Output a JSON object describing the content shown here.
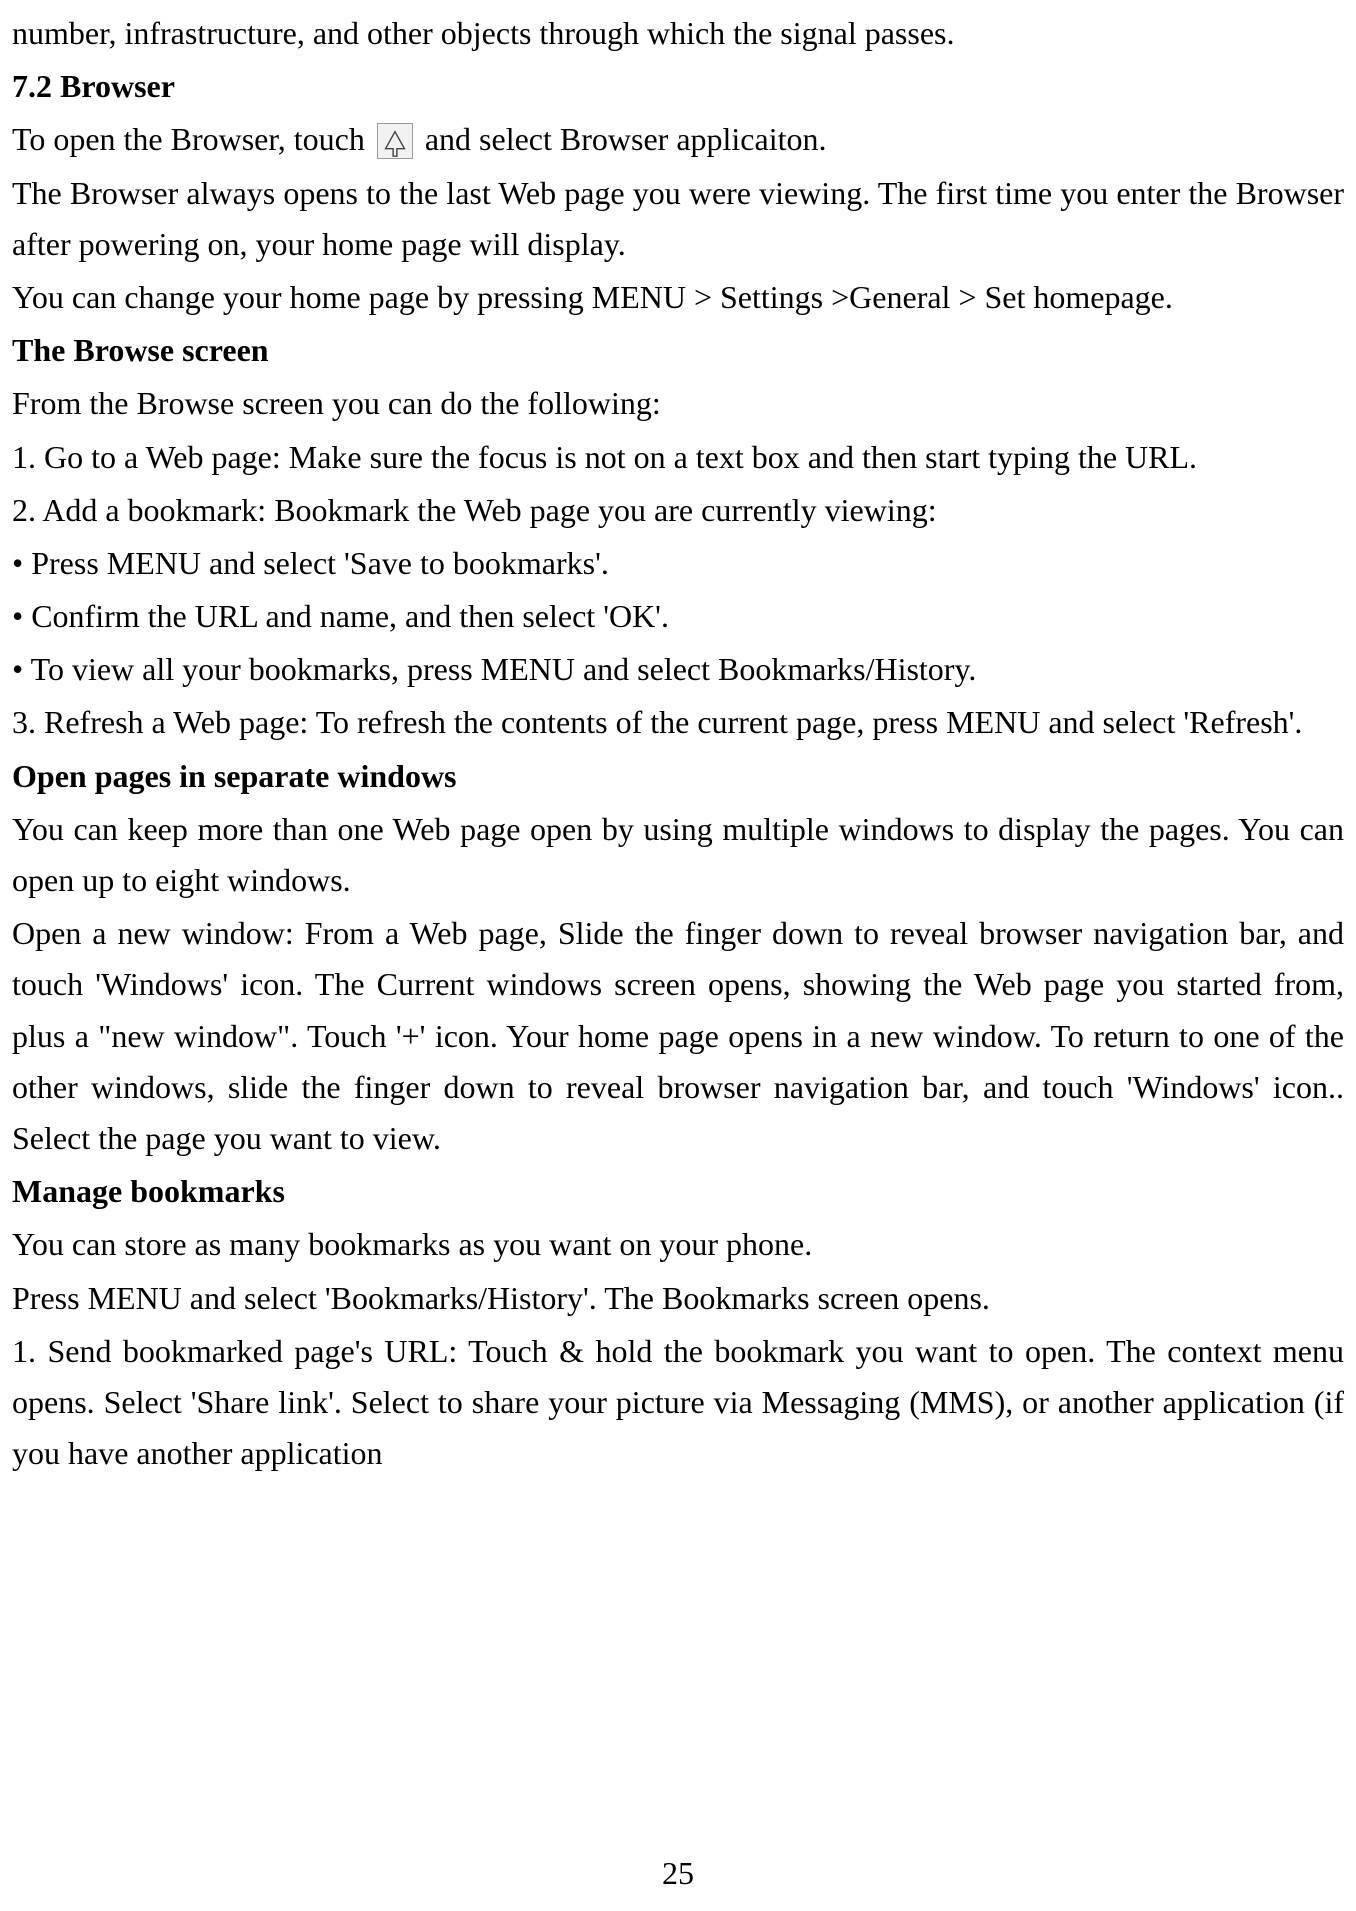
{
  "line1": "number, infrastructure, and other objects through which the signal passes.",
  "section72": "7.2 Browser",
  "openBrowserA": "To open the Browser, touch ",
  "openBrowserB": " and select Browser applicaiton.",
  "browserOpens": "The Browser always opens to the last Web page you were viewing. The first time you enter the Browser after powering on, your home page will display.",
  "changeHome": "You can change your home page by pressing MENU > Settings >General > Set homepage.",
  "browseScreenHeading": "The Browse screen",
  "browseScreenIntro": "From the Browse screen you can do the following:",
  "step1": "1. Go to a Web page: Make sure the focus is not on a text box and then start typing the URL.",
  "step2": "2. Add a bookmark: Bookmark the Web page you are currently viewing:",
  "bullet1": "• Press MENU and select 'Save to bookmarks'.",
  "bullet2": "• Confirm the URL and name, and then select 'OK'.",
  "bullet3": "• To view all your bookmarks, press MENU and select Bookmarks/History.",
  "step3": "3. Refresh a Web page: To refresh the contents of the current page, press MENU and select 'Refresh'.",
  "openPagesHeading": "Open pages in separate windows",
  "openPagesP1": "You can keep more than one Web page open by using multiple windows to display the pages. You can open up to eight windows.",
  "openPagesP2": "Open a new window: From a Web page, Slide the finger down to reveal browser navigation bar, and touch 'Windows' icon. The Current windows screen opens, showing the Web page you started from, plus a \"new window\". Touch '+' icon. Your home page opens in a new window. To return to one of the other windows, slide the finger down to reveal browser navigation bar, and touch 'Windows' icon.. Select the page you want to view.",
  "manageBookmarksHeading": "Manage bookmarks",
  "manageBookmarksP1": "You can store as many bookmarks as you want on your phone.",
  "manageBookmarksP2": "Press MENU and select 'Bookmarks/History'. The Bookmarks screen opens.",
  "manageBookmarksP3": "1. Send bookmarked page's URL: Touch & hold the bookmark you want to open. The context menu opens. Select 'Share link'. Select to share your picture via Messaging (MMS), or another application (if you have another application",
  "pageNumber": "25"
}
